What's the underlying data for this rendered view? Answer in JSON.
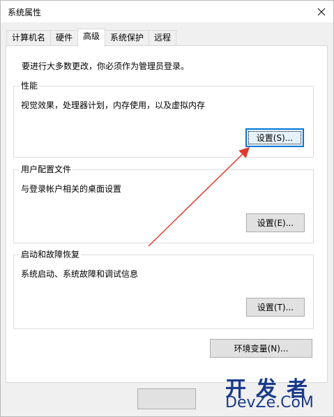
{
  "window": {
    "title": "系统属性"
  },
  "tabs": [
    {
      "label": "计算机名",
      "active": false
    },
    {
      "label": "硬件",
      "active": false
    },
    {
      "label": "高级",
      "active": true
    },
    {
      "label": "系统保护",
      "active": false
    },
    {
      "label": "远程",
      "active": false
    }
  ],
  "advanced": {
    "intro": "要进行大多数更改，你必须作为管理员登录。",
    "performance": {
      "title": "性能",
      "description": "视觉效果，处理器计划，内存使用，以及虚拟内存",
      "button": "设置(S)..."
    },
    "user_profiles": {
      "title": "用户配置文件",
      "description": "与登录帐户相关的桌面设置",
      "button": "设置(E)..."
    },
    "startup_recovery": {
      "title": "启动和故障恢复",
      "description": "系统启动、系统故障和调试信息",
      "button": "设置(T)..."
    },
    "env_button": "环境变量(N)..."
  },
  "annotation": {
    "color": "#e03a2e"
  },
  "watermark": {
    "line1": "开发者",
    "line2": "DevZe.CoM",
    "color": "#1a3a8a"
  }
}
